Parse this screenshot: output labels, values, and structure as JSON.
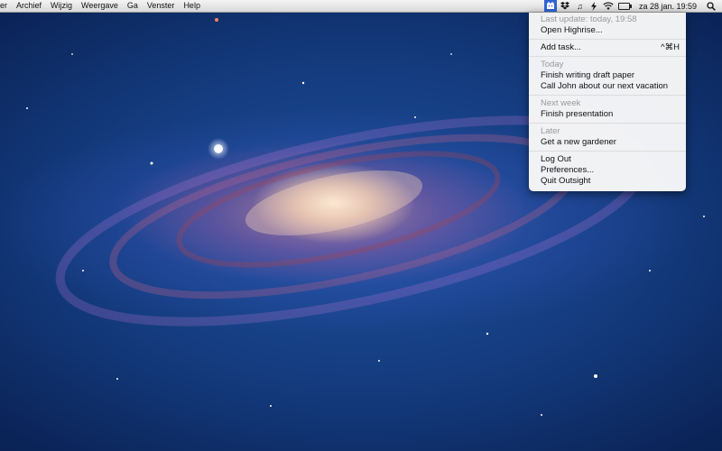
{
  "menubar": {
    "items": [
      "er",
      "Archief",
      "Wijzig",
      "Weergave",
      "Ga",
      "Venster",
      "Help"
    ],
    "status_icons": [
      "outsight-icon",
      "dropbox-icon",
      "music-icon",
      "bolt-icon",
      "wifi-icon",
      "battery-icon"
    ],
    "clock": "za 28 jan.  19:59",
    "spotlight_icon": "search-icon"
  },
  "dropdown": {
    "last_update": "Last update: today, 19:58",
    "open_highrise": "Open Highrise...",
    "add_task": "Add task...",
    "add_task_shortcut": "^⌘H",
    "today_header": "Today",
    "today_tasks": [
      "Finish writing draft paper",
      "Call John about our next vacation"
    ],
    "next_week_header": "Next week",
    "next_week_tasks": [
      "Finish presentation"
    ],
    "later_header": "Later",
    "later_tasks": [
      "Get a new gardener"
    ],
    "log_out": "Log Out",
    "preferences": "Preferences...",
    "quit": "Quit Outsight"
  },
  "colors": {
    "menu_highlight": "#2f63d3",
    "muted_text": "#9a9a9a"
  }
}
